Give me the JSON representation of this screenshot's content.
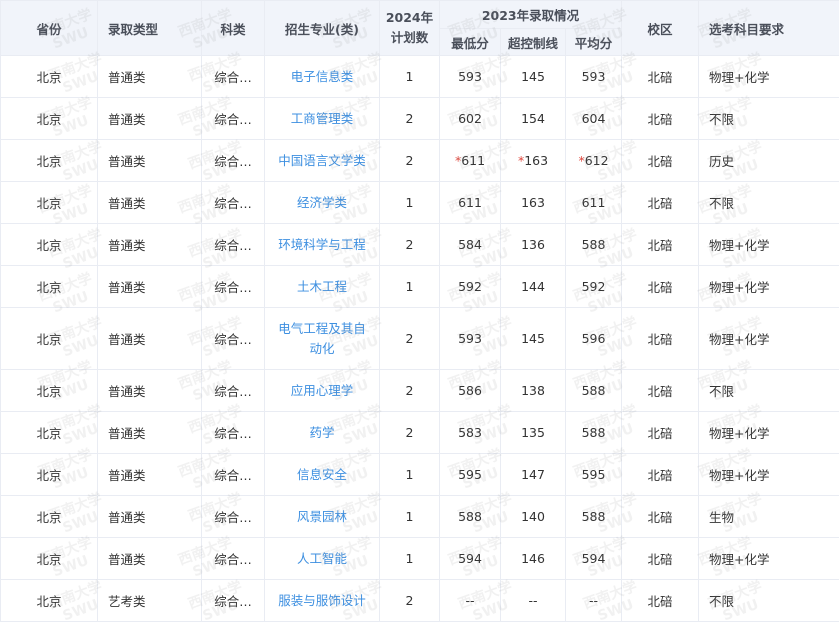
{
  "columns": {
    "province": "省份",
    "admission_type": "录取类型",
    "subject_type": "科类",
    "major": "招生专业(类)",
    "plan_2024_line1": "2024年",
    "plan_2024_line2": "计划数",
    "group_2023": "2023年录取情况",
    "min_score": "最低分",
    "above_control": "超控制线",
    "avg_score": "平均分",
    "campus": "校区",
    "subject_req": "选考科目要求"
  },
  "watermark": {
    "line1": "西南大学",
    "line2": "SWU"
  },
  "rows": [
    {
      "province": "北京",
      "type": "普通类",
      "subject": "综合…",
      "major": "电子信息类",
      "plan": "1",
      "min_mark": "",
      "min": "593",
      "above_mark": "",
      "above": "145",
      "avg_mark": "",
      "avg": "593",
      "campus": "北碚",
      "req": "物理+化学"
    },
    {
      "province": "北京",
      "type": "普通类",
      "subject": "综合…",
      "major": "工商管理类",
      "plan": "2",
      "min_mark": "",
      "min": "602",
      "above_mark": "",
      "above": "154",
      "avg_mark": "",
      "avg": "604",
      "campus": "北碚",
      "req": "不限"
    },
    {
      "province": "北京",
      "type": "普通类",
      "subject": "综合…",
      "major": "中国语言文学类",
      "plan": "2",
      "min_mark": "*",
      "min": "611",
      "above_mark": "*",
      "above": "163",
      "avg_mark": "*",
      "avg": "612",
      "campus": "北碚",
      "req": "历史"
    },
    {
      "province": "北京",
      "type": "普通类",
      "subject": "综合…",
      "major": "经济学类",
      "plan": "1",
      "min_mark": "",
      "min": "611",
      "above_mark": "",
      "above": "163",
      "avg_mark": "",
      "avg": "611",
      "campus": "北碚",
      "req": "不限"
    },
    {
      "province": "北京",
      "type": "普通类",
      "subject": "综合…",
      "major": "环境科学与工程",
      "plan": "2",
      "min_mark": "",
      "min": "584",
      "above_mark": "",
      "above": "136",
      "avg_mark": "",
      "avg": "588",
      "campus": "北碚",
      "req": "物理+化学"
    },
    {
      "province": "北京",
      "type": "普通类",
      "subject": "综合…",
      "major": "土木工程",
      "plan": "1",
      "min_mark": "",
      "min": "592",
      "above_mark": "",
      "above": "144",
      "avg_mark": "",
      "avg": "592",
      "campus": "北碚",
      "req": "物理+化学"
    },
    {
      "province": "北京",
      "type": "普通类",
      "subject": "综合…",
      "major": "电气工程及其自动化",
      "plan": "2",
      "min_mark": "",
      "min": "593",
      "above_mark": "",
      "above": "145",
      "avg_mark": "",
      "avg": "596",
      "campus": "北碚",
      "req": "物理+化学"
    },
    {
      "province": "北京",
      "type": "普通类",
      "subject": "综合…",
      "major": "应用心理学",
      "plan": "2",
      "min_mark": "",
      "min": "586",
      "above_mark": "",
      "above": "138",
      "avg_mark": "",
      "avg": "588",
      "campus": "北碚",
      "req": "不限"
    },
    {
      "province": "北京",
      "type": "普通类",
      "subject": "综合…",
      "major": "药学",
      "plan": "2",
      "min_mark": "",
      "min": "583",
      "above_mark": "",
      "above": "135",
      "avg_mark": "",
      "avg": "588",
      "campus": "北碚",
      "req": "物理+化学"
    },
    {
      "province": "北京",
      "type": "普通类",
      "subject": "综合…",
      "major": "信息安全",
      "plan": "1",
      "min_mark": "",
      "min": "595",
      "above_mark": "",
      "above": "147",
      "avg_mark": "",
      "avg": "595",
      "campus": "北碚",
      "req": "物理+化学"
    },
    {
      "province": "北京",
      "type": "普通类",
      "subject": "综合…",
      "major": "风景园林",
      "plan": "1",
      "min_mark": "",
      "min": "588",
      "above_mark": "",
      "above": "140",
      "avg_mark": "",
      "avg": "588",
      "campus": "北碚",
      "req": "生物"
    },
    {
      "province": "北京",
      "type": "普通类",
      "subject": "综合…",
      "major": "人工智能",
      "plan": "1",
      "min_mark": "",
      "min": "594",
      "above_mark": "",
      "above": "146",
      "avg_mark": "",
      "avg": "594",
      "campus": "北碚",
      "req": "物理+化学"
    },
    {
      "province": "北京",
      "type": "艺考类",
      "subject": "综合…",
      "major": "服装与服饰设计",
      "plan": "2",
      "min_mark": "",
      "min": "--",
      "above_mark": "",
      "above": "--",
      "avg_mark": "",
      "avg": "--",
      "campus": "北碚",
      "req": "不限"
    }
  ]
}
